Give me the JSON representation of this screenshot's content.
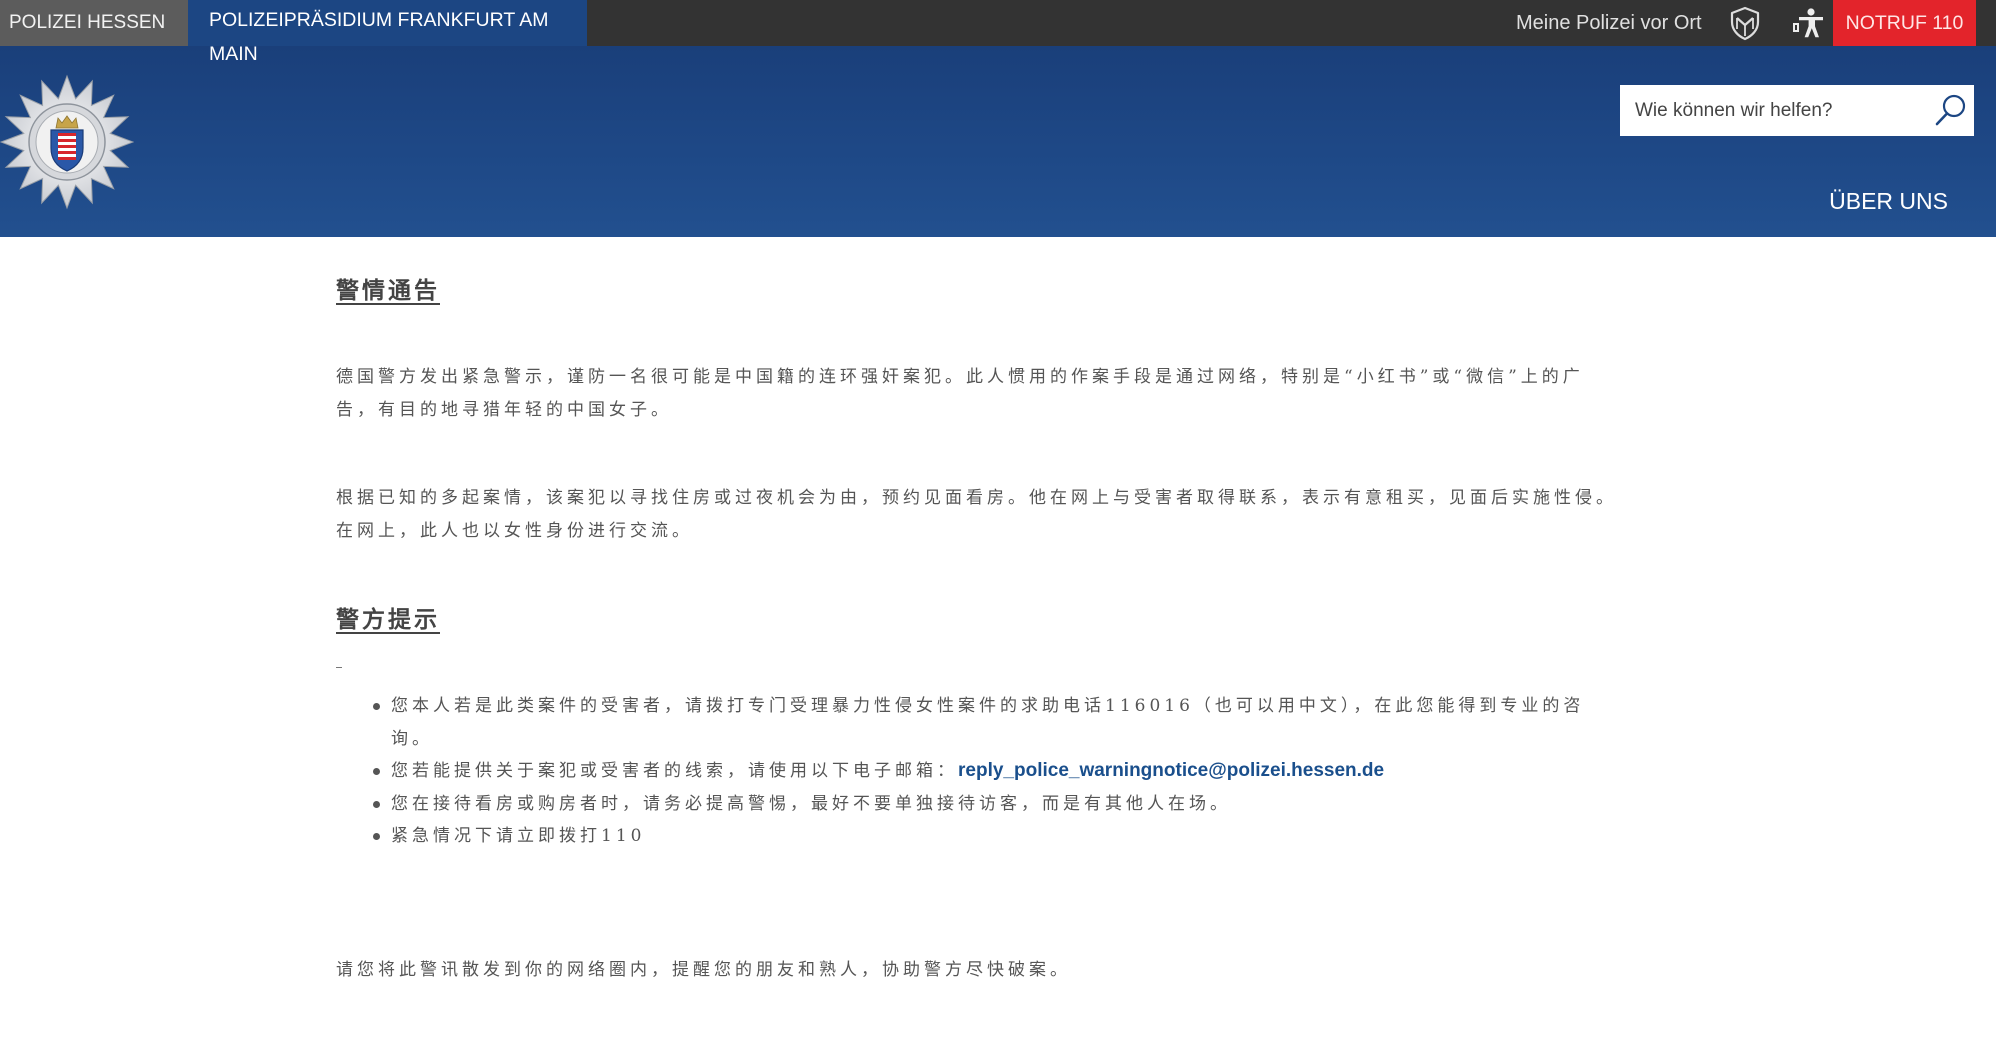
{
  "topbar": {
    "brand": "POLIZEI HESSEN",
    "site_title": "POLIZEIPRÄSIDIUM FRANKFURT AM MAIN",
    "local_police_link": "Meine Polizei vor Ort",
    "emergency_label": "NOTRUF 110"
  },
  "header": {
    "search": {
      "placeholder": "Wie können wir helfen?",
      "value": ""
    },
    "nav": {
      "about": "ÜBER UNS"
    }
  },
  "icons": {
    "logo": "police-star-crest-logo",
    "local_police": "map-shield-icon",
    "accessibility": "accessibility-icon",
    "search": "search-icon",
    "list_bullet": "bullet-dot"
  },
  "colors": {
    "topbar_bg": "#333333",
    "brand_tab_bg": "#5c5c5c",
    "header_blue": "#1c4683",
    "emergency_red": "#e3242b",
    "link_blue": "#1a4f8c",
    "body_text": "#555555"
  },
  "article": {
    "heading_notice": "警情通告",
    "paragraphs": [
      "德国警方发出紧急警示，谨防一名很可能是中国籍的连环强奸案犯。此人惯用的作案手段是通过网络，特别是“小红书”或“微信”上的广告，有目的地寻猎年轻的中国女子。",
      "根据已知的多起案情，该案犯以寻找住房或过夜机会为由，预约见面看房。他在网上与受害者取得联系，表示有意租买，见面后实施性侵。在网上，此人也以女性身份进行交流。"
    ],
    "heading_tips": "警方提示",
    "tips": [
      {
        "text": "您本人若是此类案件的受害者，请拨打专门受理暴力性侵女性案件的求助电话116016（也可以用中文），在此您能得到专业的咨询。"
      },
      {
        "text": "您若能提供关于案犯或受害者的线索，请使用以下电子邮箱：",
        "email": "reply_police_warningnotice@polizei.hessen.de"
      },
      {
        "text": "您在接待看房或购房者时，请务必提高警惕，最好不要单独接待访客，而是有其他人在场。"
      },
      {
        "text": "紧急情况下请立即拨打110"
      }
    ],
    "closing": "请您将此警讯散发到你的网络圈内，提醒您的朋友和熟人，协助警方尽快破案。"
  }
}
